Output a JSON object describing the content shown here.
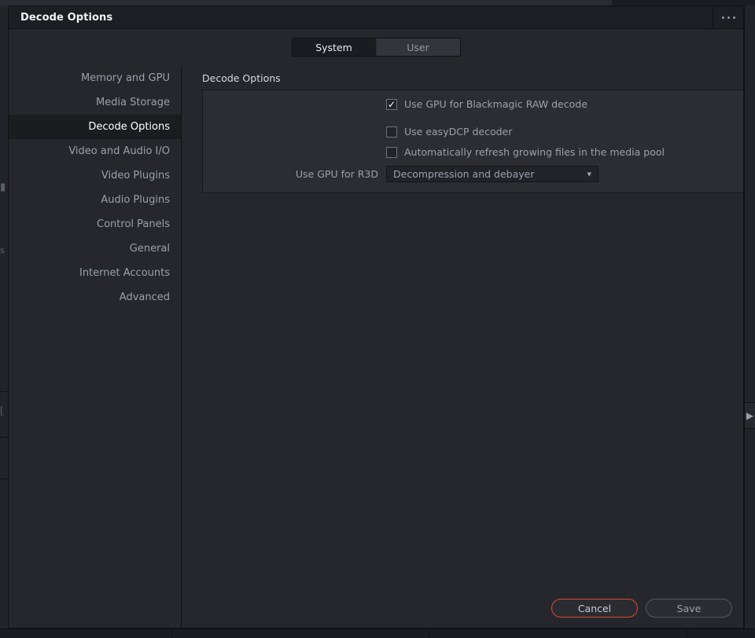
{
  "window": {
    "title": "Decode Options",
    "menu_icon": "ellipsis-icon"
  },
  "tabs": [
    {
      "label": "System",
      "active": true
    },
    {
      "label": "User",
      "active": false
    }
  ],
  "sidebar": {
    "items": [
      {
        "label": "Memory and GPU",
        "selected": false
      },
      {
        "label": "Media Storage",
        "selected": false
      },
      {
        "label": "Decode Options",
        "selected": true
      },
      {
        "label": "Video and Audio I/O",
        "selected": false
      },
      {
        "label": "Video Plugins",
        "selected": false
      },
      {
        "label": "Audio Plugins",
        "selected": false
      },
      {
        "label": "Control Panels",
        "selected": false
      },
      {
        "label": "General",
        "selected": false
      },
      {
        "label": "Internet Accounts",
        "selected": false
      },
      {
        "label": "Advanced",
        "selected": false
      }
    ]
  },
  "main": {
    "section_title": "Decode Options",
    "checkboxes": [
      {
        "label": "Use GPU for Blackmagic RAW decode",
        "checked": true
      },
      {
        "label": "Use easyDCP decoder",
        "checked": false
      },
      {
        "label": "Automatically refresh growing files in the media pool",
        "checked": false
      }
    ],
    "r3d": {
      "label": "Use GPU for R3D",
      "value": "Decompression and debayer",
      "chevron_icon": "chevron-down-icon"
    }
  },
  "footer": {
    "cancel_label": "Cancel",
    "save_label": "Save"
  },
  "background": {
    "glyph_1": "▮",
    "glyph_2": "s",
    "glyph_3": "[",
    "expander_icon": "▶"
  },
  "colors": {
    "accent_red": "#e0492c",
    "dialog_bg": "#25272c",
    "titlebar_bg": "#1d1e23",
    "panel_bg": "#2b2d33",
    "text_muted": "#9ba0a9",
    "text_bright": "#ffffff"
  }
}
